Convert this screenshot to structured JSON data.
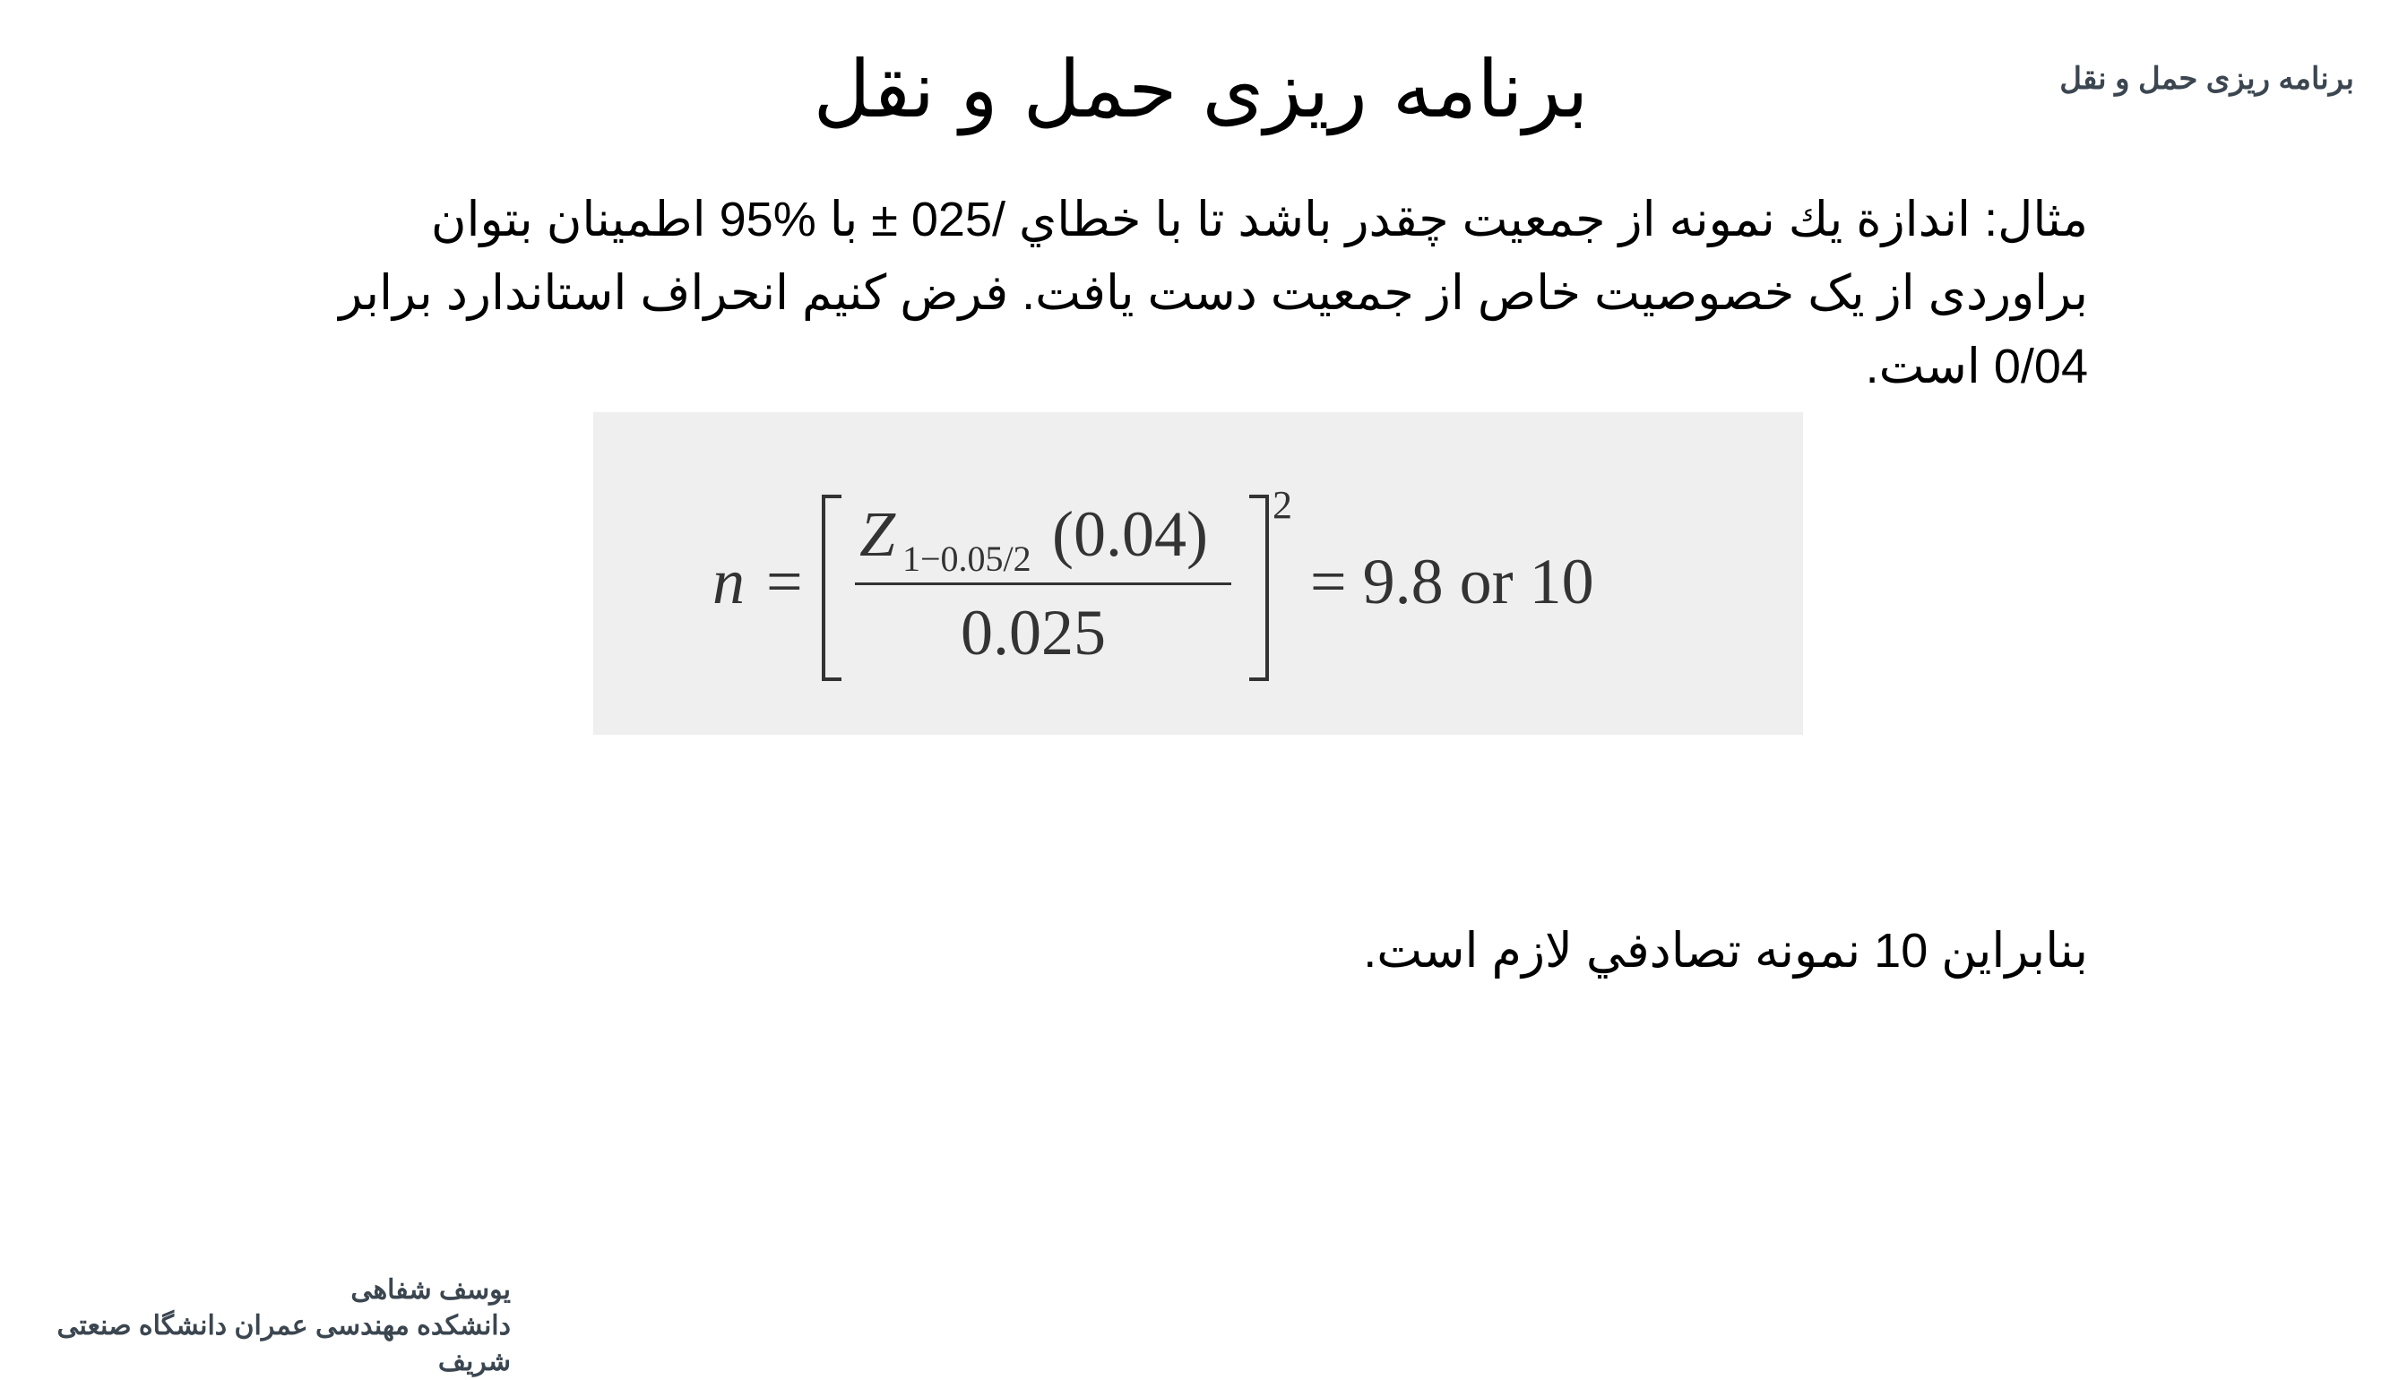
{
  "header": {
    "course_name": "برنامه ریزی حمل و نقل"
  },
  "slide": {
    "title": "برنامه ریزی حمل و نقل",
    "example_label": "مثال:",
    "example_line1": "اندازة يك نمونه از جمعيت چقدر باشد تا با خطاي",
    "error_value": "025/",
    "plusminus": "±",
    "with_word": "با",
    "confidence_value": "95%",
    "example_line1_end": "اطمينان بتوان",
    "example_line2": "براوردی از یک خصوصیت خاص از جمعیت دست یافت. فرض کنیم انحراف  استاندارد برابر",
    "std_value": "0/04",
    "example_line3_end": "است.",
    "conclusion_start": "بنابراین",
    "conclusion_count": "10",
    "conclusion_end": "نمونه تصادفي لازم است."
  },
  "formula": {
    "lhs": "n",
    "equals": "=",
    "z_symbol": "Z",
    "z_subscript": "1−0.05/2",
    "numerator_value": "(0.04)",
    "denominator": "0.025",
    "exponent": "2",
    "result": "= 9.8 or 10"
  },
  "footer": {
    "author": "يوسف شفاهی",
    "affiliation": "دانشکده مهندسی عمران  دانشگاه صنعتی شریف"
  }
}
